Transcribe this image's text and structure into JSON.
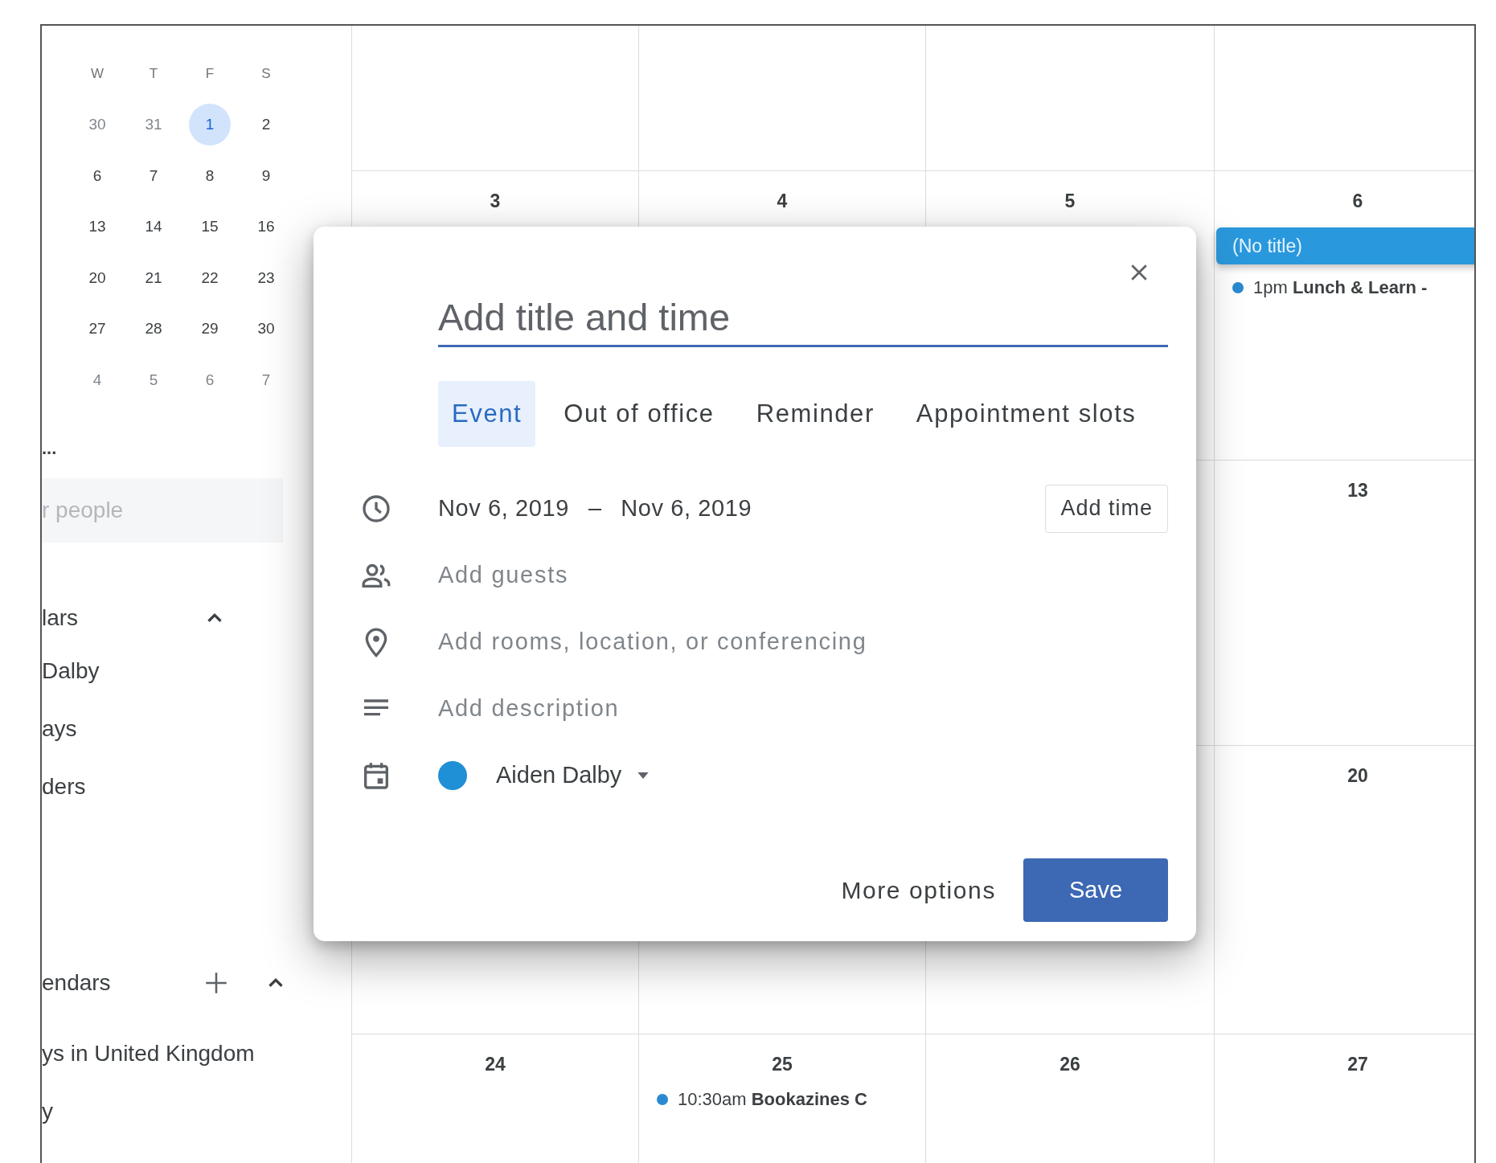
{
  "mini_calendar": {
    "weekdays": [
      "W",
      "T",
      "F",
      "S"
    ],
    "weeks": [
      [
        {
          "day": "30",
          "other_month": true,
          "selected": false
        },
        {
          "day": "31",
          "other_month": true,
          "selected": false
        },
        {
          "day": "1",
          "other_month": false,
          "selected": true
        },
        {
          "day": "2",
          "other_month": false,
          "selected": false
        }
      ],
      [
        {
          "day": "6",
          "other_month": false,
          "selected": false
        },
        {
          "day": "7",
          "other_month": false,
          "selected": false
        },
        {
          "day": "8",
          "other_month": false,
          "selected": false
        },
        {
          "day": "9",
          "other_month": false,
          "selected": false
        }
      ],
      [
        {
          "day": "13",
          "other_month": false,
          "selected": false
        },
        {
          "day": "14",
          "other_month": false,
          "selected": false
        },
        {
          "day": "15",
          "other_month": false,
          "selected": false
        },
        {
          "day": "16",
          "other_month": false,
          "selected": false
        }
      ],
      [
        {
          "day": "20",
          "other_month": false,
          "selected": false
        },
        {
          "day": "21",
          "other_month": false,
          "selected": false
        },
        {
          "day": "22",
          "other_month": false,
          "selected": false
        },
        {
          "day": "23",
          "other_month": false,
          "selected": false
        }
      ],
      [
        {
          "day": "27",
          "other_month": false,
          "selected": false
        },
        {
          "day": "28",
          "other_month": false,
          "selected": false
        },
        {
          "day": "29",
          "other_month": false,
          "selected": false
        },
        {
          "day": "30",
          "other_month": false,
          "selected": false
        }
      ],
      [
        {
          "day": "4",
          "other_month": true,
          "selected": false
        },
        {
          "day": "5",
          "other_month": true,
          "selected": false
        },
        {
          "day": "6",
          "other_month": true,
          "selected": false
        },
        {
          "day": "7",
          "other_month": true,
          "selected": false
        }
      ]
    ]
  },
  "sidebar": {
    "truncated_item": "...",
    "search": {
      "placeholder": "r people"
    },
    "sections": [
      {
        "title": "lars",
        "expanded": true,
        "items": [
          "Dalby",
          "ays",
          "ders"
        ]
      },
      {
        "title": "endars",
        "add_button": true,
        "expanded": true,
        "items": [
          "ys in United Kingdom",
          "y"
        ]
      }
    ]
  },
  "calendar": {
    "rows": [
      {
        "cells": [
          {},
          {},
          {},
          {}
        ]
      },
      {
        "cells": [
          {
            "day": "3"
          },
          {
            "day": "4"
          },
          {
            "day": "5"
          },
          {
            "day": "6",
            "events": [
              {
                "kind": "chip",
                "title": "(No title)",
                "color": "#2a98dc"
              },
              {
                "kind": "dot",
                "time": "1pm",
                "title": "Lunch & Learn -",
                "color": "#2a8ad0"
              }
            ]
          }
        ]
      },
      {
        "cells": [
          {},
          {},
          {},
          {
            "day": "13"
          }
        ]
      },
      {
        "cells": [
          {},
          {},
          {},
          {
            "day": "20"
          }
        ]
      },
      {
        "cells": [
          {
            "day": "24"
          },
          {
            "day": "25",
            "events": [
              {
                "kind": "dot",
                "time": "10:30am",
                "title": "Bookazines C",
                "color": "#2a8ad0"
              }
            ]
          },
          {
            "day": "26"
          },
          {
            "day": "27"
          }
        ]
      }
    ]
  },
  "dialog": {
    "title_placeholder": "Add title and time",
    "tabs": [
      {
        "label": "Event",
        "selected": true
      },
      {
        "label": "Out of office",
        "selected": false
      },
      {
        "label": "Reminder",
        "selected": false
      },
      {
        "label": "Appointment slots",
        "selected": false
      }
    ],
    "date_start": "Nov 6, 2019",
    "date_separator": "–",
    "date_end": "Nov 6, 2019",
    "add_time_button": "Add time",
    "fields": [
      {
        "kind": "guests",
        "placeholder": "Add guests"
      },
      {
        "kind": "location",
        "placeholder": "Add rooms, location, or conferencing"
      },
      {
        "kind": "description",
        "placeholder": "Add description"
      }
    ],
    "calendar": {
      "name": "Aiden Dalby",
      "color": "#1f8fd6"
    },
    "more_options": "More options",
    "save": "Save"
  }
}
